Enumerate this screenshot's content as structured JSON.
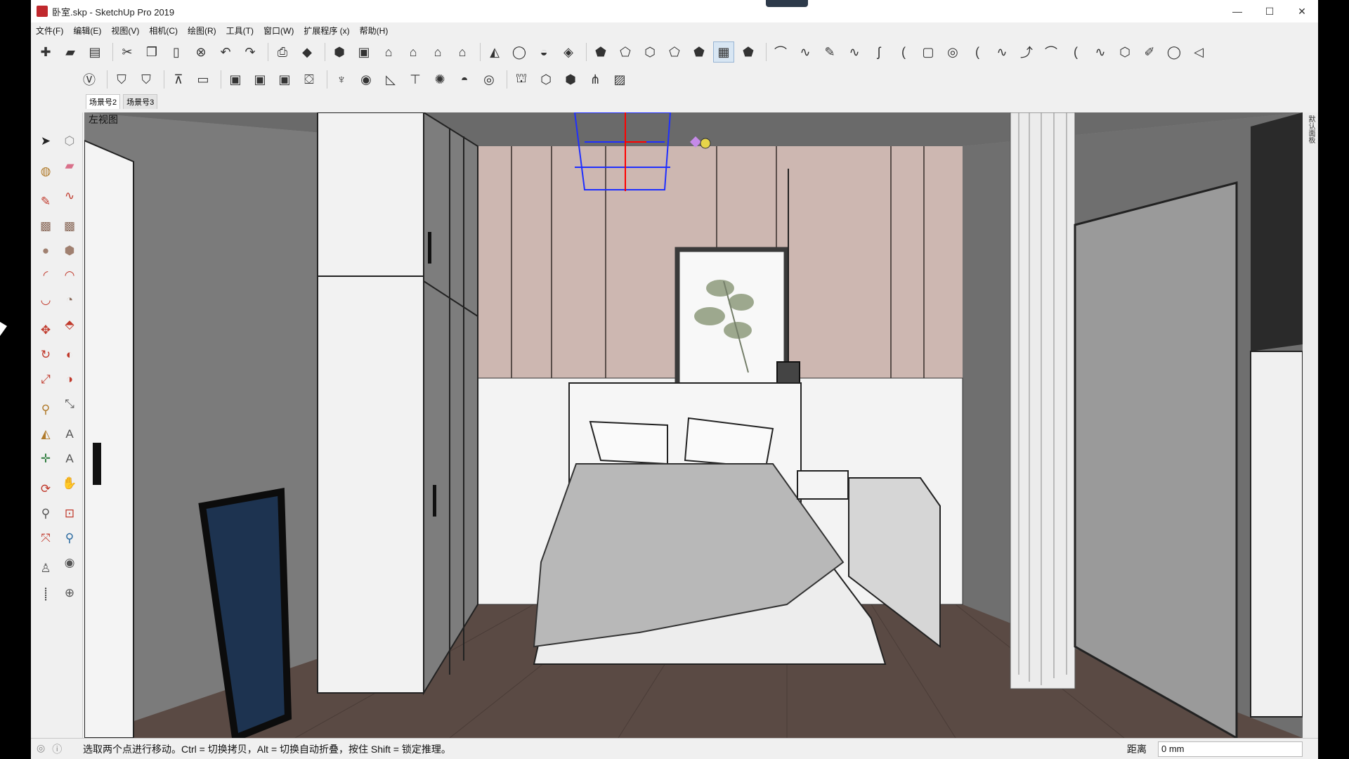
{
  "window": {
    "title": "卧室.skp - SketchUp Pro 2019",
    "controls": {
      "minimize": "—",
      "maximize": "☐",
      "close": "✕"
    }
  },
  "menu": [
    "文件(F)",
    "编辑(E)",
    "视图(V)",
    "相机(C)",
    "绘图(R)",
    "工具(T)",
    "窗口(W)",
    "扩展程序 (x)",
    "帮助(H)"
  ],
  "toolbar_row1": [
    {
      "icon": "new-model-icon",
      "glyph": "✚"
    },
    {
      "icon": "open-folder-icon",
      "glyph": "▰"
    },
    {
      "icon": "save-icon",
      "glyph": "▤"
    },
    {
      "icon": "cut-icon",
      "glyph": "✂"
    },
    {
      "icon": "copy-icon",
      "glyph": "❐"
    },
    {
      "icon": "paste-icon",
      "glyph": "▯"
    },
    {
      "icon": "erase-icon",
      "glyph": "⊗"
    },
    {
      "icon": "undo-icon",
      "glyph": "↶"
    },
    {
      "icon": "redo-icon",
      "glyph": "↷"
    },
    {
      "icon": "print-icon",
      "glyph": "⎙"
    },
    {
      "icon": "model-info-icon",
      "glyph": "◆"
    },
    {
      "icon": "iso-view-icon",
      "glyph": "⬢"
    },
    {
      "icon": "top-view-icon",
      "glyph": "▣"
    },
    {
      "icon": "front-view-icon",
      "glyph": "⌂"
    },
    {
      "icon": "right-view-icon",
      "glyph": "⌂"
    },
    {
      "icon": "back-view-icon",
      "glyph": "⌂"
    },
    {
      "icon": "left-view-icon",
      "glyph": "⌂"
    },
    {
      "icon": "section-plane-icon",
      "glyph": "◭"
    },
    {
      "icon": "outer-shell-icon",
      "glyph": "◯"
    },
    {
      "icon": "solid-tools-icon",
      "glyph": "◒"
    },
    {
      "icon": "sandbox-icon",
      "glyph": "◈"
    },
    {
      "icon": "xray-icon",
      "glyph": "⬟"
    },
    {
      "icon": "back-edges-icon",
      "glyph": "⬠"
    },
    {
      "icon": "wireframe-icon",
      "glyph": "⬡"
    },
    {
      "icon": "hidden-line-icon",
      "glyph": "⬠"
    },
    {
      "icon": "shaded-icon",
      "glyph": "⬟"
    },
    {
      "icon": "shaded-textures-icon",
      "glyph": "▦"
    },
    {
      "icon": "monochrome-icon",
      "glyph": "⬟"
    },
    {
      "icon": "curve-tool-1-icon",
      "glyph": "⌒"
    },
    {
      "icon": "curve-tool-2-icon",
      "glyph": "∿"
    },
    {
      "icon": "curve-tool-3-icon",
      "glyph": "✎"
    },
    {
      "icon": "curve-tool-4-icon",
      "glyph": "∿"
    },
    {
      "icon": "curve-tool-5-icon",
      "glyph": "ʃ"
    },
    {
      "icon": "curve-tool-6-icon",
      "glyph": "("
    },
    {
      "icon": "curve-tool-7-icon",
      "glyph": "▢"
    },
    {
      "icon": "curve-tool-8-icon",
      "glyph": "◎"
    },
    {
      "icon": "curve-tool-9-icon",
      "glyph": "("
    },
    {
      "icon": "curve-tool-10-icon",
      "glyph": "∿"
    },
    {
      "icon": "curve-tool-11-icon",
      "glyph": "⤴"
    },
    {
      "icon": "curve-tool-12-icon",
      "glyph": "⌒"
    },
    {
      "icon": "curve-tool-13-icon",
      "glyph": "("
    },
    {
      "icon": "curve-tool-14-icon",
      "glyph": "∿"
    },
    {
      "icon": "curve-tool-15-icon",
      "glyph": "⬡"
    },
    {
      "icon": "curve-tool-16-icon",
      "glyph": "✐"
    },
    {
      "icon": "curve-tool-17-icon",
      "glyph": "◯"
    },
    {
      "icon": "curve-tool-18-icon",
      "glyph": "◁"
    }
  ],
  "toolbar_row2": [
    {
      "icon": "style-icon",
      "glyph": "Ⓥ"
    },
    {
      "icon": "component-1-icon",
      "glyph": "⛉"
    },
    {
      "icon": "component-2-icon",
      "glyph": "⛉"
    },
    {
      "icon": "layer-1-icon",
      "glyph": "⊼"
    },
    {
      "icon": "layer-2-icon",
      "glyph": "▭"
    },
    {
      "icon": "frame-1-icon",
      "glyph": "▣"
    },
    {
      "icon": "frame-2-icon",
      "glyph": "▣"
    },
    {
      "icon": "frame-3-icon",
      "glyph": "▣"
    },
    {
      "icon": "lock-icon",
      "glyph": "⛋"
    },
    {
      "icon": "light-1-icon",
      "glyph": "♆"
    },
    {
      "icon": "light-2-icon",
      "glyph": "◉"
    },
    {
      "icon": "light-3-icon",
      "glyph": "◺"
    },
    {
      "icon": "light-4-icon",
      "glyph": "⊤"
    },
    {
      "icon": "sun-icon",
      "glyph": "✺"
    },
    {
      "icon": "dome-icon",
      "glyph": "◓"
    },
    {
      "icon": "sphere-icon",
      "glyph": "◎"
    },
    {
      "icon": "render-1-icon",
      "glyph": "⛫"
    },
    {
      "icon": "render-2-icon",
      "glyph": "⬡"
    },
    {
      "icon": "render-3-icon",
      "glyph": "⬢"
    },
    {
      "icon": "render-4-icon",
      "glyph": "⋔"
    },
    {
      "icon": "render-5-icon",
      "glyph": "▨"
    }
  ],
  "scene_tabs": [
    "场景号2",
    "场景号3"
  ],
  "view_label": "左视图",
  "left_tools": [
    {
      "icon": "select-arrow-icon",
      "glyph": "➤",
      "color": "#222"
    },
    {
      "icon": "make-component-icon",
      "glyph": "⬡",
      "color": "#888"
    },
    {
      "icon": "paint-bucket-icon",
      "glyph": "◍",
      "color": "#b07a2a"
    },
    {
      "icon": "eraser-icon",
      "glyph": "▰",
      "color": "#d9708a"
    },
    {
      "icon": "pencil-line-icon",
      "glyph": "✎",
      "color": "#c0392b"
    },
    {
      "icon": "freehand-icon",
      "glyph": "∿",
      "color": "#c0392b"
    },
    {
      "icon": "rectangle-icon",
      "glyph": "▩",
      "color": "#8a6a5a"
    },
    {
      "icon": "rotated-rect-icon",
      "glyph": "▩",
      "color": "#8a6a5a"
    },
    {
      "icon": "circle-icon",
      "glyph": "●",
      "color": "#a08070"
    },
    {
      "icon": "polygon-icon",
      "glyph": "⬢",
      "color": "#a08070"
    },
    {
      "icon": "arc-icon",
      "glyph": "◜",
      "color": "#c0392b"
    },
    {
      "icon": "two-point-arc-icon",
      "glyph": "◠",
      "color": "#c0392b"
    },
    {
      "icon": "three-point-arc-icon",
      "glyph": "◡",
      "color": "#c0392b"
    },
    {
      "icon": "pie-icon",
      "glyph": "◔",
      "color": "#8a6a5a"
    },
    {
      "icon": "move-icon",
      "glyph": "✥",
      "color": "#c0392b"
    },
    {
      "icon": "push-pull-icon",
      "glyph": "⬘",
      "color": "#c0392b"
    },
    {
      "icon": "rotate-icon",
      "glyph": "↻",
      "color": "#c0392b"
    },
    {
      "icon": "follow-me-icon",
      "glyph": "◐",
      "color": "#c0392b"
    },
    {
      "icon": "scale-icon",
      "glyph": "⤢",
      "color": "#c0392b"
    },
    {
      "icon": "offset-icon",
      "glyph": "◑",
      "color": "#c0392b"
    },
    {
      "icon": "tape-measure-icon",
      "glyph": "⚲",
      "color": "#b07a2a"
    },
    {
      "icon": "dimension-icon",
      "glyph": "⤡",
      "color": "#555"
    },
    {
      "icon": "protractor-icon",
      "glyph": "◭",
      "color": "#b07a2a"
    },
    {
      "icon": "text-icon",
      "glyph": "A",
      "color": "#555"
    },
    {
      "icon": "axes-icon",
      "glyph": "✛",
      "color": "#2a7a3a"
    },
    {
      "icon": "3d-text-icon",
      "glyph": "A",
      "color": "#555"
    },
    {
      "icon": "orbit-icon",
      "glyph": "⟳",
      "color": "#c0392b"
    },
    {
      "icon": "pan-icon",
      "glyph": "✋",
      "color": "#b07a2a"
    },
    {
      "icon": "zoom-icon",
      "glyph": "⚲",
      "color": "#555"
    },
    {
      "icon": "zoom-window-icon",
      "glyph": "⊡",
      "color": "#c0392b"
    },
    {
      "icon": "zoom-extents-icon",
      "glyph": "⤧",
      "color": "#c0392b"
    },
    {
      "icon": "previous-view-icon",
      "glyph": "⚲",
      "color": "#2a6aa0"
    },
    {
      "icon": "position-camera-icon",
      "glyph": "♙",
      "color": "#555"
    },
    {
      "icon": "look-around-icon",
      "glyph": "◉",
      "color": "#555"
    },
    {
      "icon": "walk-icon",
      "glyph": "⸽",
      "color": "#333"
    },
    {
      "icon": "section-plane-tool-icon",
      "glyph": "⊕",
      "color": "#555"
    }
  ],
  "status": {
    "hint": "选取两个点进行移动。Ctrl = 切换拷贝，Alt = 切换自动折叠，按住 Shift = 锁定推理。",
    "measure_label": "距离",
    "measure_value": "0 mm"
  },
  "right_panel_label": "默认面板",
  "viewport_scene": {
    "artwork_title": "",
    "poster_text": "",
    "colors": {
      "wall_left": "#7b7b7b",
      "back_wall": "#cdb7b1",
      "back_wall_lower": "#ffffff",
      "floor": "#5a4a44",
      "ceiling": "#6a6a6a",
      "wardrobe": "#f2f2f2",
      "wardrobe_shadow": "#7d7d7d",
      "selection_box": "#1f2fff",
      "axis_red": "#ff0000",
      "bed_white": "#f4f4f4",
      "poster_blue": "#1d3350"
    }
  }
}
